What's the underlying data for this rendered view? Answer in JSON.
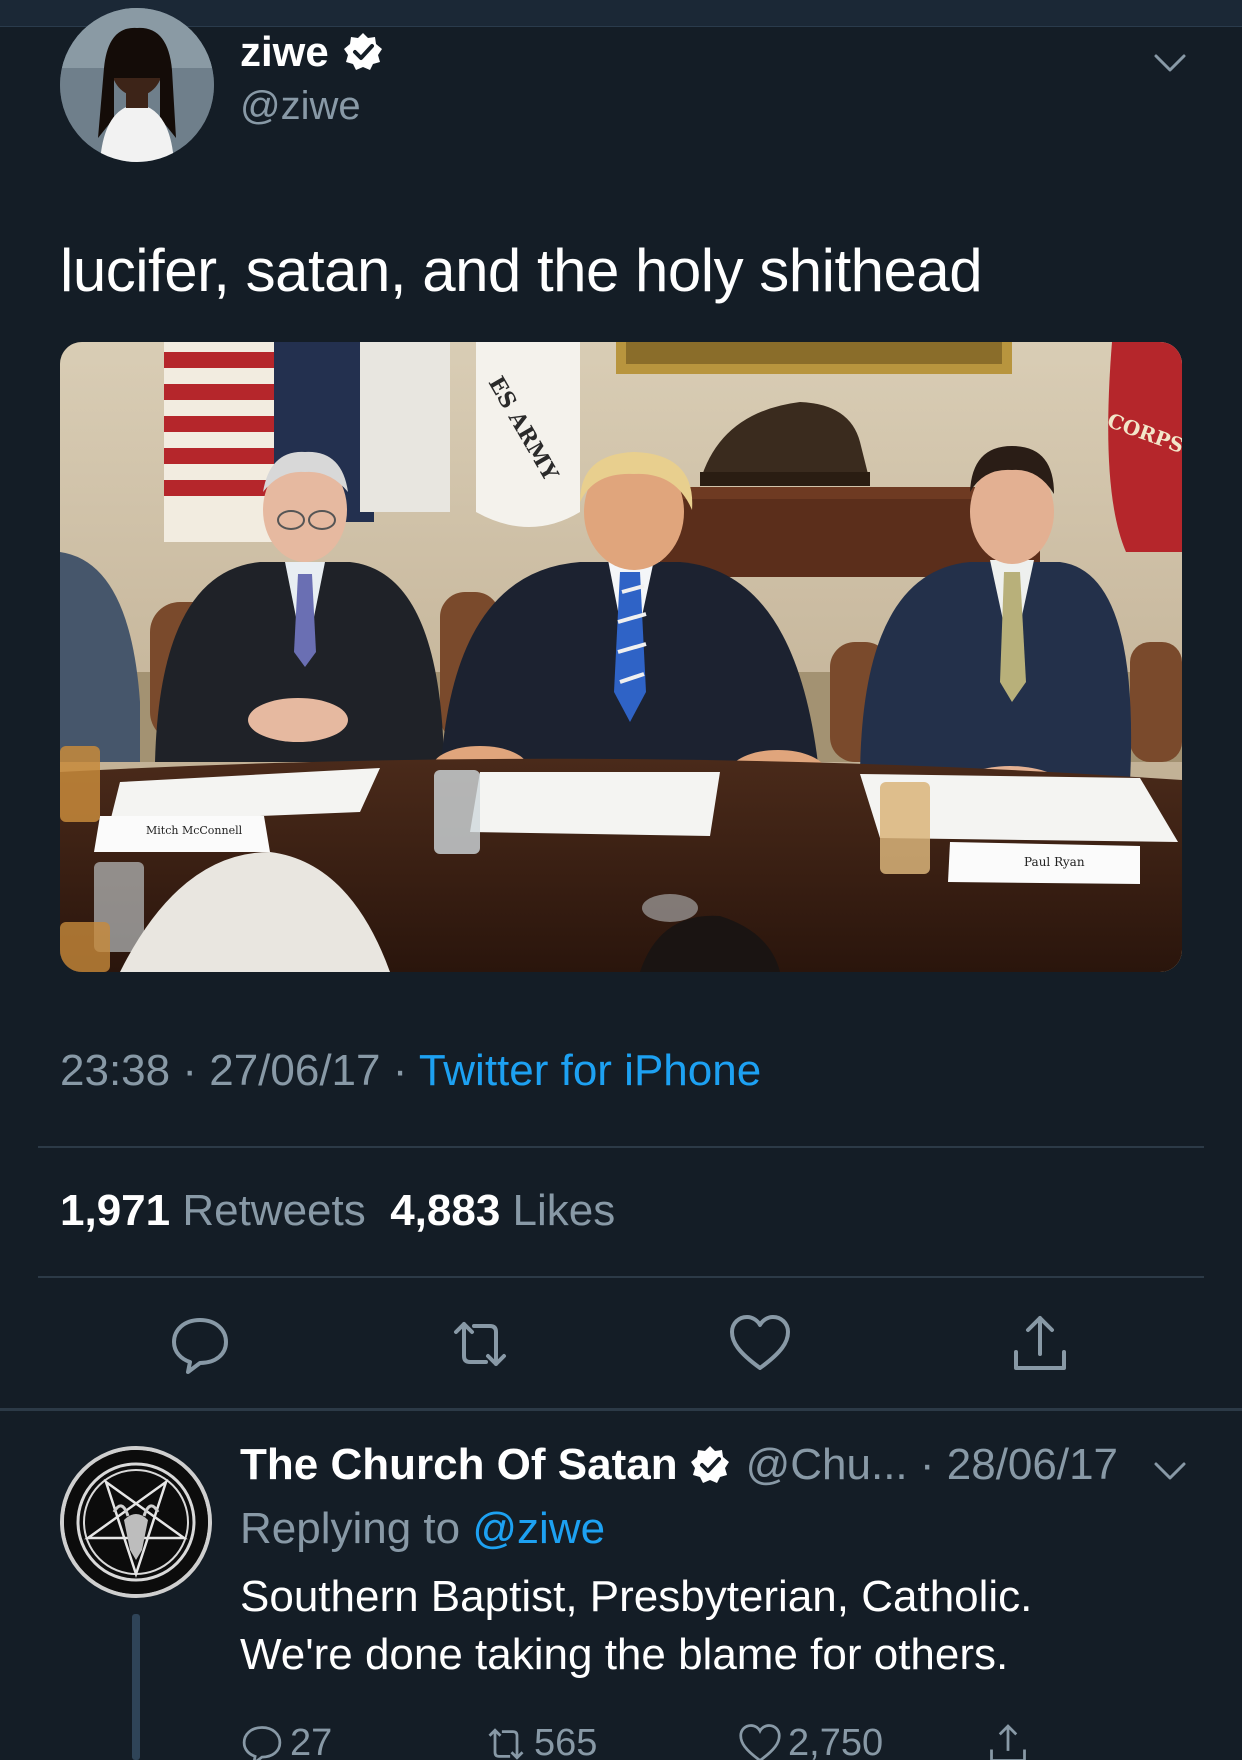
{
  "tweet": {
    "author_name": "ziwe",
    "author_handle": "@ziwe",
    "text": "lucifer, satan, and the holy shithead",
    "time": "23:38",
    "date": "27/06/17",
    "separator": " · ",
    "source": "Twitter for iPhone",
    "retweets_count": "1,971",
    "retweets_label": " Retweets",
    "likes_count": "4,883",
    "likes_label": " Likes",
    "photo_labels": {
      "flag_left": "ES ARMY",
      "flag_right": "CORPS",
      "placard_left": "Mitch McConnell",
      "placard_right": "Paul Ryan"
    }
  },
  "reply": {
    "author_name": "The Church Of Satan",
    "meta": "@Chu... · 28/06/17",
    "replying_prefix": "Replying to ",
    "replying_handle": "@ziwe",
    "line1": "Southern Baptist, Presbyterian, Catholic.",
    "line2": "We're done taking the blame for others.",
    "reply_count": "27",
    "retweet_count": "565",
    "like_count": "2,750"
  },
  "icons": [
    "verified-badge-icon",
    "chevron-down-icon",
    "reply-icon",
    "retweet-icon",
    "like-icon",
    "share-icon"
  ],
  "colors": {
    "background": "#141d26",
    "accent": "#1da1f2",
    "muted": "#8899a6",
    "divider": "#2c3a47"
  }
}
